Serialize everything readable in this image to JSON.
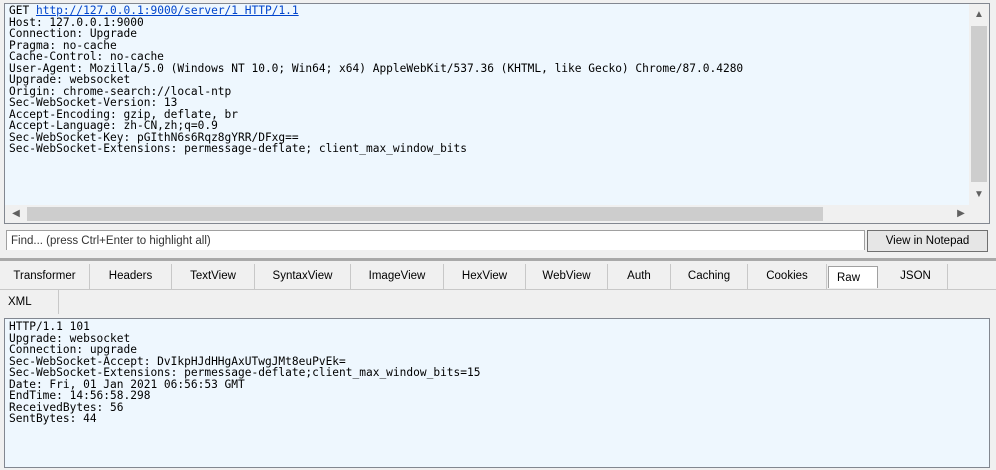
{
  "request": {
    "method": "GET",
    "url": "http://127.0.0.1:9000/server/1 HTTP/1.1",
    "headers": [
      "Host: 127.0.0.1:9000",
      "Connection: Upgrade",
      "Pragma: no-cache",
      "Cache-Control: no-cache",
      "User-Agent: Mozilla/5.0 (Windows NT 10.0; Win64; x64) AppleWebKit/537.36 (KHTML, like Gecko) Chrome/87.0.4280",
      "Upgrade: websocket",
      "Origin: chrome-search://local-ntp",
      "Sec-WebSocket-Version: 13",
      "Accept-Encoding: gzip, deflate, br",
      "Accept-Language: zh-CN,zh;q=0.9",
      "Sec-WebSocket-Key: pGIthN6s6Rqz8gYRR/DFxg==",
      "Sec-WebSocket-Extensions: permessage-deflate; client_max_window_bits"
    ]
  },
  "find": {
    "placeholder": "Find... (press Ctrl+Enter to highlight all)",
    "button_label": "View in Notepad"
  },
  "tabs": {
    "row1": [
      "Transformer",
      "Headers",
      "TextView",
      "SyntaxView",
      "ImageView",
      "HexView",
      "WebView",
      "Auth",
      "Caching",
      "Cookies",
      "Raw",
      "JSON"
    ],
    "row2": [
      "XML"
    ],
    "active": "Raw"
  },
  "response": {
    "lines": [
      "HTTP/1.1 101",
      "Upgrade: websocket",
      "Connection: upgrade",
      "Sec-WebSocket-Accept: DvIkpHJdHHgAxUTwgJMt8euPvEk=",
      "Sec-WebSocket-Extensions: permessage-deflate;client_max_window_bits=15",
      "Date: Fri, 01 Jan 2021 06:56:53 GMT",
      "EndTime: 14:56:58.298",
      "ReceivedBytes: 56",
      "SentBytes: 44"
    ]
  },
  "icons": {
    "scroll_up": "chevron-up-icon",
    "scroll_down": "chevron-down-icon",
    "scroll_left": "chevron-left-icon",
    "scroll_right": "chevron-right-icon"
  },
  "colors": {
    "pane_bg": "#eef7fe",
    "link": "#0044cc"
  }
}
